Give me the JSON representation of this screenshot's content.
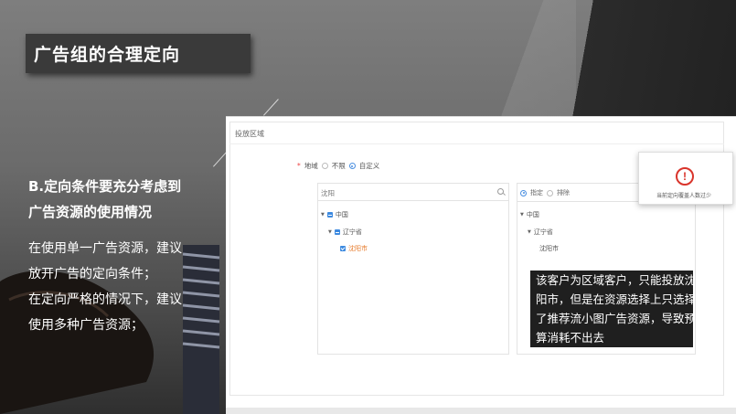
{
  "slide": {
    "title": "广告组的合理定向",
    "subhead_line1": "B.定向条件要充分考虑到",
    "subhead_line2": "广告资源的使用情况",
    "body_lines": [
      "在使用单一广告资源，建议",
      "放开广告的定向条件；",
      "在定向严格的情况下，建议",
      "使用多种广告资源；"
    ]
  },
  "panel": {
    "header": "投放区域",
    "region_label": "地域",
    "option_unlimited": "不限",
    "option_custom": "自定义",
    "search_value": "沈阳",
    "left_tree": {
      "country": "中国",
      "province": "辽宁省",
      "city": "沈阳市"
    },
    "right_tabs": {
      "include": "指定",
      "exclude": "排除"
    },
    "right_tree": {
      "country": "中国",
      "province": "辽宁省",
      "city": "沈阳市"
    }
  },
  "callout": {
    "lines": [
      "该客户为区域客户，只能投放沈",
      "阳市，但是在资源选择上只选择",
      "了推荐流小图广告资源，导致预",
      "算消耗不出去"
    ]
  },
  "warning": {
    "icon": "exclamation-circle-icon",
    "text": "当前定向覆盖人数过少",
    "color": "#d9342b"
  }
}
